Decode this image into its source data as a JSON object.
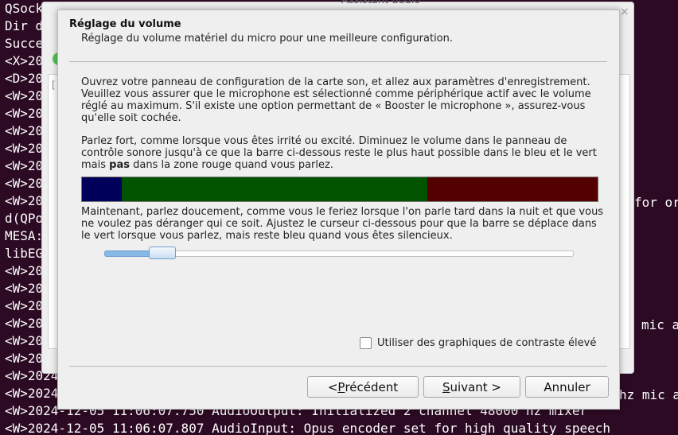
{
  "terminal": {
    "lines": [
      "QSock",
      "Dir d",
      "Succe",
      "<X>20",
      "<D>20",
      "<W>20",
      "<W>20",
      "<W>20",
      "<W>20",
      "<W>20",
      "<W>20",
      "<W>20",
      "d(QPo",
      "MESA:",
      "libEG",
      "<W>20",
      "<W>20",
      "<W>20",
      "<W>20",
      "<W>20",
      "<W>20",
      "<W>2024",
      "<W>2024",
      "<W>2024-12-05 11:06:07.750 AudioOutput: Initialized 2 channel 48000 hz mixer",
      "<W>2024-12-05 11:06:07.807 AudioInput: Opus encoder set for high quality speech"
    ],
    "right_for": "for or",
    "right_mic1": "mic a",
    "right_mic2": "hz mic a"
  },
  "back_window": {
    "title": "Assistant audio",
    "close_glyph": "×",
    "pane_prefix": "["
  },
  "dialog": {
    "title": "Réglage du volume",
    "subtitle": "Réglage du volume matériel du micro pour une meilleure configuration.",
    "para1": "Ouvrez votre panneau de configuration de la carte son, et allez aux paramètres d'enregistrement. Veuillez vous assurer que le microphone est sélectionné comme périphérique actif avec le volume réglé au maximum. S'il existe une option permettant de « Booster le microphone », assurez-vous qu'elle soit cochée.",
    "para2_before": "Parlez fort, comme lorsque vous êtes irrité ou excité. Diminuez le volume dans le panneau de contrôle sonore jusqu'à ce que la barre ci-dessous reste le plus haut possible dans le bleu et le vert mais ",
    "para2_bold": "pas",
    "para2_after": " dans la zone rouge quand vous parlez.",
    "para3": "Maintenant, parlez doucement, comme vous le feriez lorsque l'on parle tard dans la nuit et que vous ne voulez pas déranger qui ce soit. Ajustez le curseur ci-dessous pour que la barre se déplace dans le vert lorsque vous parlez, mais reste bleu quand vous êtes silencieux.",
    "meter": {
      "blue": 0.077,
      "green": 0.593,
      "red": 0.33,
      "colors": {
        "blue": "#00005a",
        "green": "#005400",
        "red": "#540000"
      }
    },
    "slider": {
      "value": 0.1
    },
    "contrast_checkbox": {
      "label": "Utiliser des graphiques de contraste élevé",
      "checked": false
    },
    "buttons": {
      "prev": {
        "before": "< ",
        "mnemonic": "P",
        "after": "récédent"
      },
      "next": {
        "mnemonic": "S",
        "after": "uivant >"
      },
      "cancel": "Annuler"
    }
  }
}
